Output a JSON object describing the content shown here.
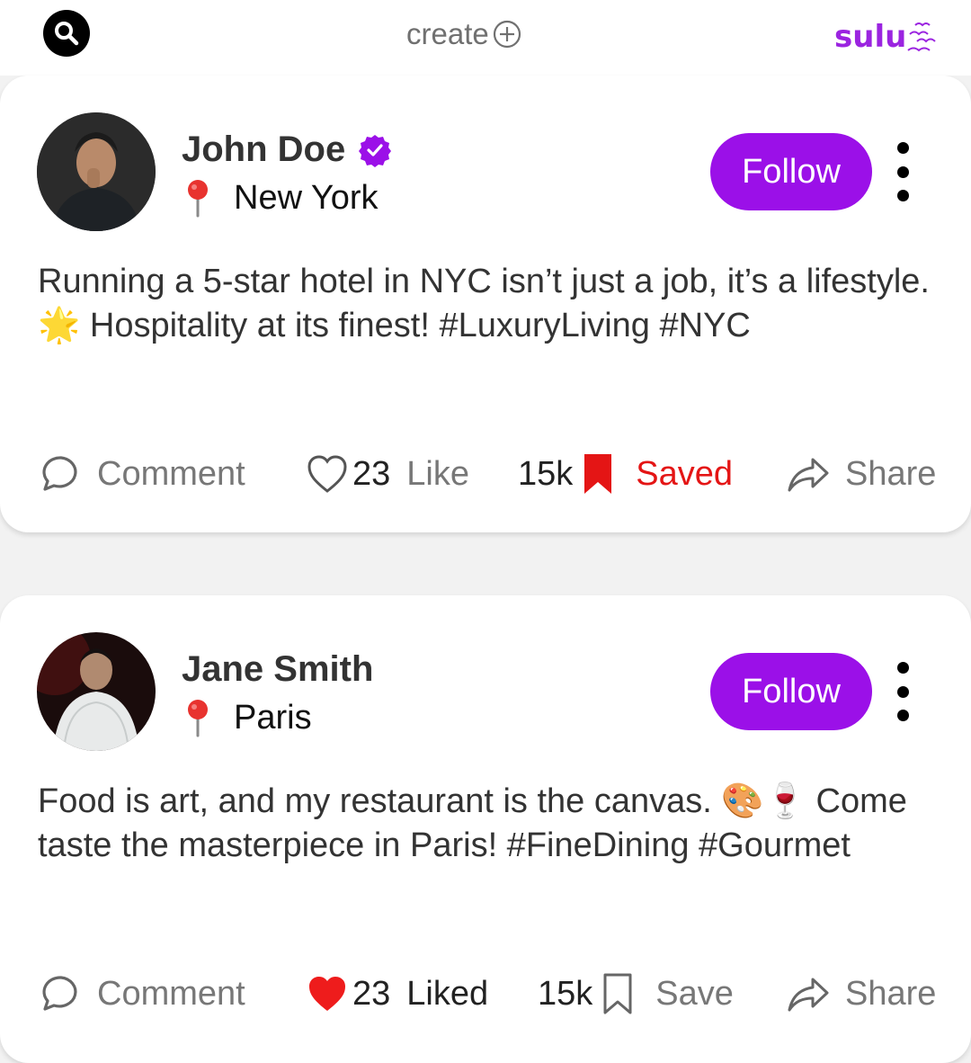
{
  "header": {
    "search_icon": "search-icon",
    "create_label": "create",
    "create_icon": "plus-circle-icon",
    "brand": "sulu",
    "brand_icon": "birds-icon",
    "brand_color": "#9b24e0"
  },
  "accent_color": "#9b10e8",
  "posts": [
    {
      "name": "John Doe",
      "verified": true,
      "location": "New York",
      "follow_label": "Follow",
      "text": "Running a 5-star hotel in NYC isn’t just a job, it’s a lifestyle. 🌟 Hospitality at its finest! #LuxuryLiving #NYC",
      "comment_label": "Comment",
      "like_count": "23",
      "like_label": "Like",
      "liked": false,
      "save_count": "15k",
      "save_label": "Saved",
      "saved": true,
      "share_label": "Share"
    },
    {
      "name": "Jane Smith",
      "verified": false,
      "location": "Paris",
      "follow_label": "Follow",
      "text": "Food is art, and my restaurant is the canvas. 🎨🍷 Come taste the masterpiece in Paris! #FineDining #Gourmet",
      "comment_label": "Comment",
      "like_count": "23",
      "like_label": "Liked",
      "liked": true,
      "save_count": "15k",
      "save_label": "Save",
      "saved": false,
      "share_label": "Share"
    }
  ]
}
